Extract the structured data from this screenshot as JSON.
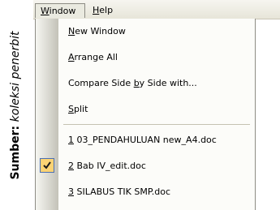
{
  "caption": {
    "label": "Sumber:",
    "value": "koleksi penerbit"
  },
  "menubar": {
    "window": {
      "pre": "",
      "key": "W",
      "post": "indow"
    },
    "help": {
      "pre": "",
      "key": "H",
      "post": "elp"
    }
  },
  "menu": {
    "new_window": {
      "pre": "",
      "key": "N",
      "post": "ew Window"
    },
    "arrange_all": {
      "pre": "",
      "key": "A",
      "post": "rrange All"
    },
    "compare": {
      "pre": "Compare Side ",
      "key": "b",
      "post": "y Side with..."
    },
    "split": {
      "pre": "",
      "key": "S",
      "post": "plit"
    },
    "doc1": {
      "pre": "",
      "key": "1",
      "post": " 03_PENDAHULUAN new_A4.doc"
    },
    "doc2": {
      "pre": "",
      "key": "2",
      "post": " Bab IV_edit.doc",
      "checked": true
    },
    "doc3": {
      "pre": "",
      "key": "3",
      "post": " SILABUS TIK SMP.doc"
    }
  },
  "icons": {
    "check": "checkmark-icon"
  },
  "colors": {
    "check_bg": "#fbd374",
    "check_border": "#4a6fb3"
  }
}
